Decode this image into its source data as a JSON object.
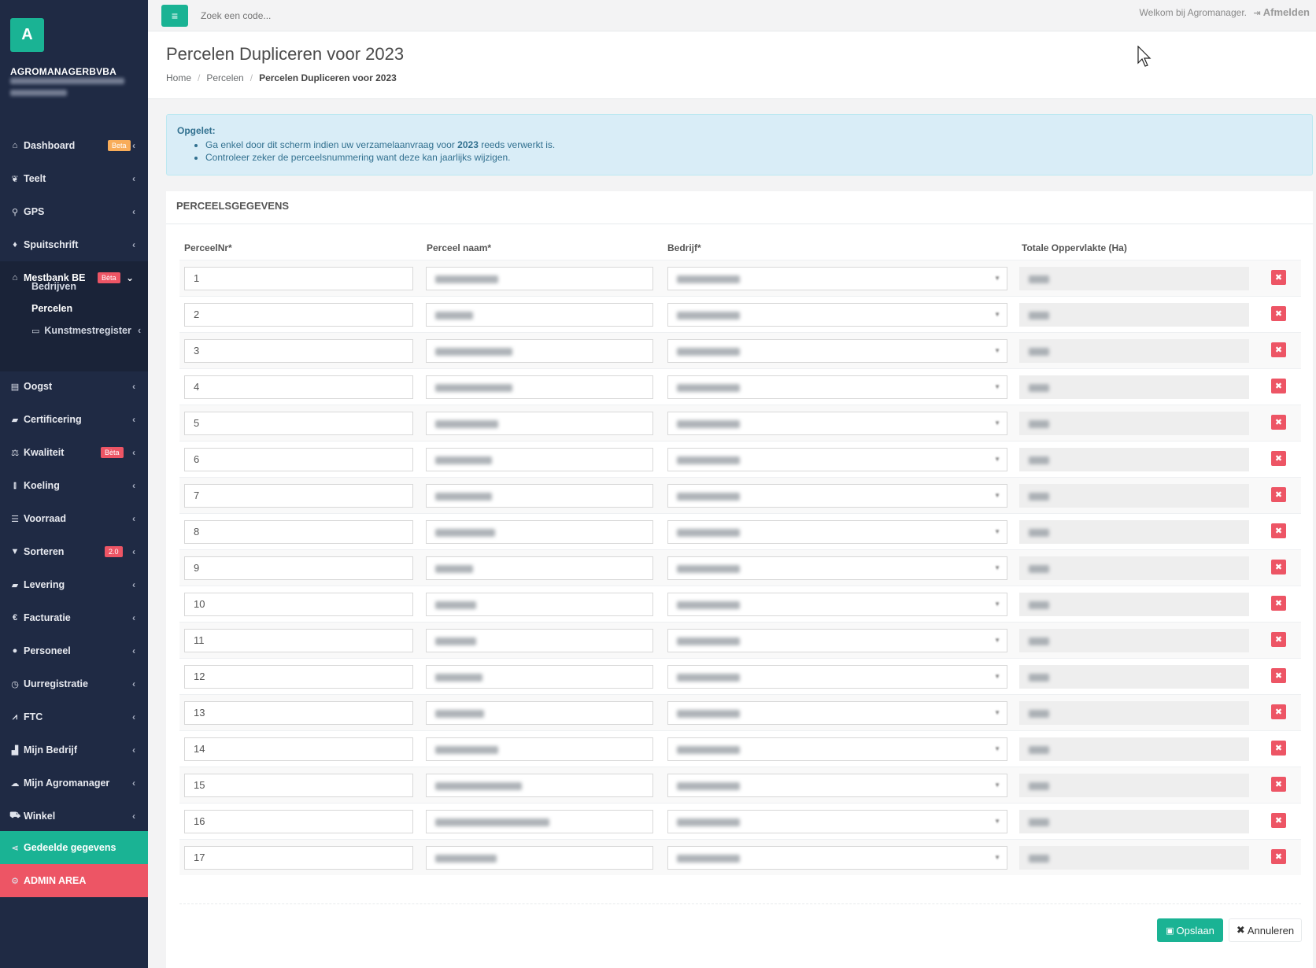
{
  "sidebar": {
    "logo_letter": "A",
    "company": "AGROMANAGERBVBA",
    "items": [
      {
        "label": "Dashboard",
        "icon": "home-icon",
        "glyph": "⌂",
        "badge": "Beta"
      },
      {
        "label": "Teelt",
        "icon": "leaf-icon",
        "glyph": "❦"
      },
      {
        "label": "GPS",
        "icon": "map-marker-icon",
        "glyph": "⚲"
      },
      {
        "label": "Spuitschrift",
        "icon": "tint-icon",
        "glyph": "♦"
      },
      {
        "label": "Mestbank BE",
        "icon": "bank-icon",
        "glyph": "⌂",
        "badge": "Bèta"
      },
      {
        "label": "Oogst",
        "icon": "basket-icon",
        "glyph": "▤"
      },
      {
        "label": "Certificering",
        "icon": "book-icon",
        "glyph": "▰"
      },
      {
        "label": "Kwaliteit",
        "icon": "balance-scale-icon",
        "glyph": "⚖",
        "badge": "Bèta"
      },
      {
        "label": "Koeling",
        "icon": "thermometer-icon",
        "glyph": "⫾"
      },
      {
        "label": "Voorraad",
        "icon": "list-icon",
        "glyph": "☰"
      },
      {
        "label": "Sorteren",
        "icon": "filter-icon",
        "glyph": "▼",
        "badge": "2.0"
      },
      {
        "label": "Levering",
        "icon": "truck-icon",
        "glyph": "▰"
      },
      {
        "label": "Facturatie",
        "icon": "euro-icon",
        "glyph": "€"
      },
      {
        "label": "Personeel",
        "icon": "user-icon",
        "glyph": "●"
      },
      {
        "label": "Uurregistratie",
        "icon": "clock-icon",
        "glyph": "◷"
      },
      {
        "label": "FTC",
        "icon": "line-chart-icon",
        "glyph": "⩘"
      },
      {
        "label": "Mijn Bedrijf",
        "icon": "bar-chart-icon",
        "glyph": "▟"
      },
      {
        "label": "Mijn Agromanager",
        "icon": "cloud-icon",
        "glyph": "☁"
      },
      {
        "label": "Winkel",
        "icon": "cart-icon",
        "glyph": "⛟"
      }
    ],
    "submenu": {
      "bedrijven": "Bedrijven",
      "percelen": "Percelen",
      "kunstmest": "Kunstmestregister"
    },
    "shared": "Gedeelde gegevens",
    "admin": "ADMIN AREA"
  },
  "topbar": {
    "search_placeholder": "Zoek een code...",
    "welcome": "Welkom bij Agromanager.",
    "logout": "Afmelden"
  },
  "heading": {
    "title": "Percelen Dupliceren voor 2023",
    "breadcrumb": [
      "Home",
      "Percelen",
      "Percelen Dupliceren voor 2023"
    ]
  },
  "alert": {
    "title": "Opgelet:",
    "line1_pre": "Ga enkel door dit scherm indien uw verzamelaanvraag voor ",
    "line1_year": "2023",
    "line1_post": " reeds verwerkt is.",
    "line2": "Controleer zeker de perceelsnummering want deze kan jaarlijks wijzigen."
  },
  "panel": {
    "title": "PERCEELSGEGEVENS",
    "columns": [
      "PerceelNr*",
      "Perceel naam*",
      "Bedrijf*",
      "Totale Oppervlakte (Ha)"
    ],
    "rows": [
      "1",
      "2",
      "3",
      "4",
      "5",
      "6",
      "7",
      "8",
      "9",
      "10",
      "11",
      "12",
      "13",
      "14",
      "15",
      "16",
      "17"
    ],
    "save": "Opslaan",
    "cancel": "Annuleren"
  },
  "colors": {
    "sidebar_bg": "#1f2a44",
    "accent": "#1ab394",
    "danger": "#ed5565",
    "alert_bg": "#d9edf7"
  }
}
